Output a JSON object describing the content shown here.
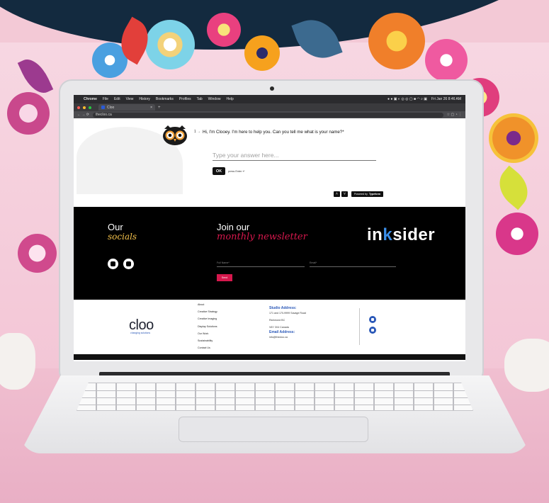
{
  "browser": {
    "menu": [
      "Chrome",
      "File",
      "Edit",
      "View",
      "History",
      "Bookmarks",
      "Profiles",
      "Tab",
      "Window",
      "Help"
    ],
    "clock": "Fri Jan 26 8:46 AM",
    "tab_title": "Cloo",
    "tab_close": "×",
    "new_tab": "+",
    "nav_icons": "← → ⟳",
    "url": "thecloo.ca"
  },
  "typeform": {
    "question_number": "1 →",
    "question": "Hi, I'm Clooey. I'm here to help you. Can you tell me what is your name?*",
    "answer_placeholder": "Type your answer here...",
    "ok_label": "OK",
    "hint": "press Enter ↵",
    "nav_up": "˄",
    "nav_down": "˅",
    "powered_prefix": "Powered by",
    "powered_brand": "Typeform"
  },
  "newsletter": {
    "socials_title": "Our",
    "socials_title_em": "socials",
    "social_icons": [
      "instagram-icon",
      "linkedin-icon"
    ],
    "join_title": "Join our",
    "join_title_em": "monthly newsletter",
    "full_name_placeholder": "Full Name*",
    "email_placeholder": "Email*",
    "send_label": "Send",
    "brand_pre": "in",
    "brand_k": "k",
    "brand_post": "sider"
  },
  "footer": {
    "logo": "cloo",
    "tagline": "changing solutions",
    "links": [
      "About",
      "Creative Strategy",
      "Creative Imaging",
      "Display Solutions",
      "Our Work",
      "Sustainability",
      "Contact Us"
    ],
    "studio_heading": "Studio Address:",
    "studio_line1": "171 and 170-9999 Savage Road",
    "studio_line2": "Richmond BC",
    "studio_line3": "V6Y 3X4 Canada",
    "email_heading": "Email Address:",
    "email": "info@thecloo.ca",
    "social_icons": [
      "instagram-icon",
      "linkedin-icon"
    ]
  },
  "colors": {
    "accent_pink": "#d6184d",
    "accent_gold": "#f2c04a",
    "accent_blue": "#2a58b8",
    "navy": "#132a3f"
  }
}
